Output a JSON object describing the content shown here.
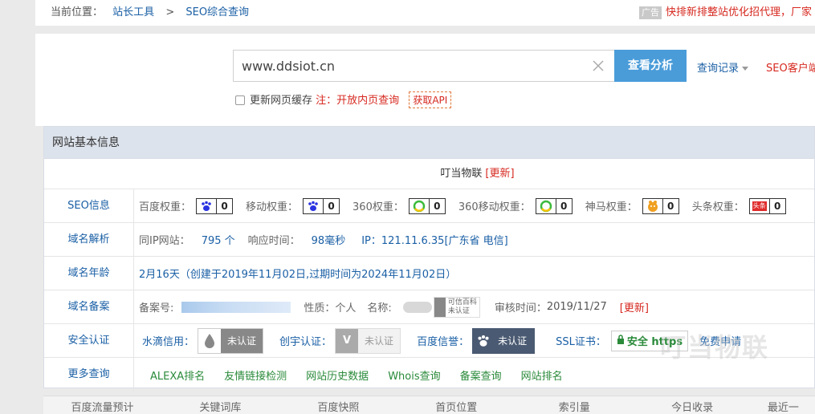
{
  "breadcrumb": {
    "prefix": "当前位置：",
    "items": [
      "站长工具",
      "SEO综合查询"
    ],
    "sep": ">"
  },
  "ad": {
    "tag": "广告",
    "text": "快排新排整站优化招代理，厂家"
  },
  "search": {
    "value": "www.ddsiot.cn",
    "button": "查看分析",
    "history": "查询记录",
    "client": "SEO客户端",
    "refresh_label": "更新网页缓存",
    "note": "注：开放内页查询",
    "api": "获取API"
  },
  "panel": {
    "title": "网站基本信息",
    "site_name": "叮当物联",
    "site_update": "[更新]"
  },
  "seo": {
    "label": "SEO信息",
    "weights": [
      {
        "name": "百度权重：",
        "value": "0",
        "icon": "baidu-paw-icon"
      },
      {
        "name": "移动权重：",
        "value": "0",
        "icon": "baidu-paw-icon"
      },
      {
        "name": "360权重：",
        "value": "0",
        "icon": "360-icon"
      },
      {
        "name": "360移动权重：",
        "value": "0",
        "icon": "360-icon"
      },
      {
        "name": "神马权重：",
        "value": "0",
        "icon": "shenma-icon"
      },
      {
        "name": "头条权重：",
        "value": "0",
        "icon": "toutiao-icon"
      }
    ],
    "toutiao_tag": "头条"
  },
  "domain_resolve": {
    "label": "域名解析",
    "same_ip_label": "同IP网站：",
    "same_ip_value": "795 个",
    "response_label": "响应时间：",
    "response_value": "98毫秒",
    "ip_label": "IP：",
    "ip_value": "121.11.6.35[广东省 电信]"
  },
  "domain_age": {
    "label": "域名年龄",
    "value": "2月16天（创建于2019年11月02日,过期时间为2024年11月02日）"
  },
  "icp": {
    "label": "域名备案",
    "number_label": "备案号:",
    "nature_label": "性质：",
    "nature_value": "个人",
    "name_label": "名称:",
    "baike_line1": "可信百科",
    "baike_line2": "未认证",
    "review_label": "审核时间：",
    "review_value": "2019/11/27",
    "update": "[更新]"
  },
  "security": {
    "label": "安全认证",
    "shuidi_label": "水滴信用：",
    "shuidi_value": "未认证",
    "chuangyu_label": "创宇认证：",
    "chuangyu_value": "未认证",
    "baidu_label": "百度信誉：",
    "baidu_value": "未认证",
    "ssl_label": "SSL证书：",
    "ssl_value": "安全 https",
    "free_apply": "免费申请"
  },
  "more": {
    "label": "更多查询",
    "links": [
      "ALEXA排名",
      "友情链接检测",
      "网站历史数据",
      "Whois查询",
      "备案查询",
      "网站排名"
    ]
  },
  "tabs": [
    "百度流量预计",
    "关键词库",
    "百度快照",
    "首页位置",
    "索引量",
    "今日收录",
    "最近一"
  ],
  "watermark": "叮当物联"
}
